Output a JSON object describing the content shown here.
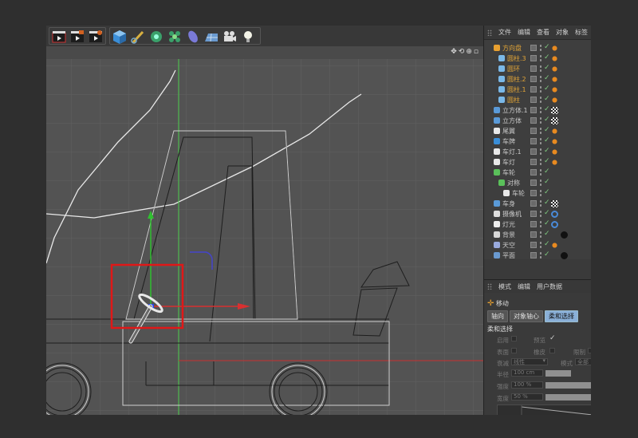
{
  "panel_menu": [
    "文件",
    "编辑",
    "查看",
    "对象",
    "标签"
  ],
  "objects": [
    {
      "name": "方向盘",
      "orange": true,
      "indent": 0
    },
    {
      "name": "圆柱.3",
      "orange": true,
      "indent": 1
    },
    {
      "name": "圆环",
      "orange": true,
      "indent": 1
    },
    {
      "name": "圆柱.2",
      "orange": true,
      "indent": 1
    },
    {
      "name": "圆柱.1",
      "orange": true,
      "indent": 1
    },
    {
      "name": "圆柱",
      "orange": true,
      "indent": 1
    },
    {
      "name": "立方体.1",
      "orange": false,
      "indent": 0
    },
    {
      "name": "立方体",
      "orange": false,
      "indent": 0
    },
    {
      "name": "尾翼",
      "orange": false,
      "indent": 0
    },
    {
      "name": "车牌",
      "orange": false,
      "indent": 0
    },
    {
      "name": "车灯.1",
      "orange": false,
      "indent": 0
    },
    {
      "name": "车灯",
      "orange": false,
      "indent": 0
    },
    {
      "name": "车轮",
      "orange": false,
      "indent": 0
    },
    {
      "name": "对称",
      "orange": false,
      "indent": 1
    },
    {
      "name": "车轮",
      "orange": false,
      "indent": 2
    },
    {
      "name": "车身",
      "orange": false,
      "indent": 0
    },
    {
      "name": "摄像机",
      "orange": false,
      "indent": 0
    },
    {
      "name": "灯光",
      "orange": false,
      "indent": 0
    },
    {
      "name": "背景",
      "orange": false,
      "indent": 0
    },
    {
      "name": "天空",
      "orange": false,
      "indent": 0
    },
    {
      "name": "平面",
      "orange": false,
      "indent": 0
    }
  ],
  "attr_menu": [
    "模式",
    "编辑",
    "用户数据"
  ],
  "attr_title": "移动",
  "attr_tabs": [
    "轴向",
    "对象轴心",
    "柔和选择"
  ],
  "section_title": "柔和选择",
  "fields": {
    "enable": "启用",
    "preview": "预览",
    "surface": "表面",
    "rubber": "橡皮",
    "restrict": "限制",
    "falloff_type": "衰减",
    "falloff_value": "线性",
    "mode": "模式",
    "mode_value": "全部",
    "radius": "半径",
    "radius_value": "100 cm",
    "strength": "强度",
    "strength_value": "100 %",
    "width": "宽度",
    "width_value": "50 %"
  }
}
